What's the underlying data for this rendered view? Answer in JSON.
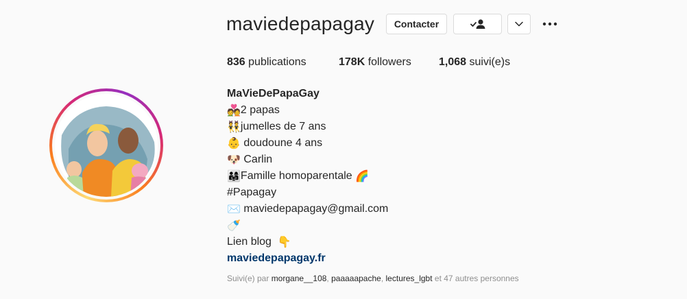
{
  "profile": {
    "username": "maviedepapagay",
    "buttons": {
      "contact": "Contacter"
    },
    "stats": {
      "posts_value": "836",
      "posts_label": "publications",
      "followers_value": "178K",
      "followers_label": "followers",
      "following_value": "1,068",
      "following_label": "suivi(e)s"
    },
    "bio": {
      "display_name": "MaVieDePapaGay",
      "lines": [
        {
          "emoji": "💑",
          "text": "2 papas"
        },
        {
          "emoji": "👯",
          "text": "jumelles de 7 ans"
        },
        {
          "emoji": "👶",
          "text": " doudoune 4 ans"
        },
        {
          "emoji": "🐶",
          "text": " Carlin"
        },
        {
          "emoji": "👨‍👩‍👧",
          "text": "Famille homoparentale ",
          "emoji_after": "🌈"
        },
        {
          "emoji": "",
          "text": "#Papagay"
        },
        {
          "emoji": "✉️",
          "text": " maviedepapagay@gmail.com"
        },
        {
          "emoji": "🍼",
          "text": ""
        },
        {
          "emoji": "",
          "text": "Lien blog  ",
          "emoji_after": "👇"
        }
      ],
      "link": "maviedepapagay.fr"
    },
    "followed_by": {
      "prefix": "Suivi(e) par ",
      "accounts": [
        "morgane__108",
        "paaaaapache",
        "lectures_lgbt"
      ],
      "sep1": ", ",
      "sep2": ", ",
      "suffix": " et 47 autres personnes"
    },
    "icons": {
      "follow": "person-check-icon",
      "chevron": "chevron-down-icon",
      "more": "more-horizontal-icon"
    },
    "colors": {
      "link": "#00376b",
      "secondary_text": "#8e8e8e",
      "ring_start": "#feda75",
      "ring_end": "#d62976"
    }
  }
}
